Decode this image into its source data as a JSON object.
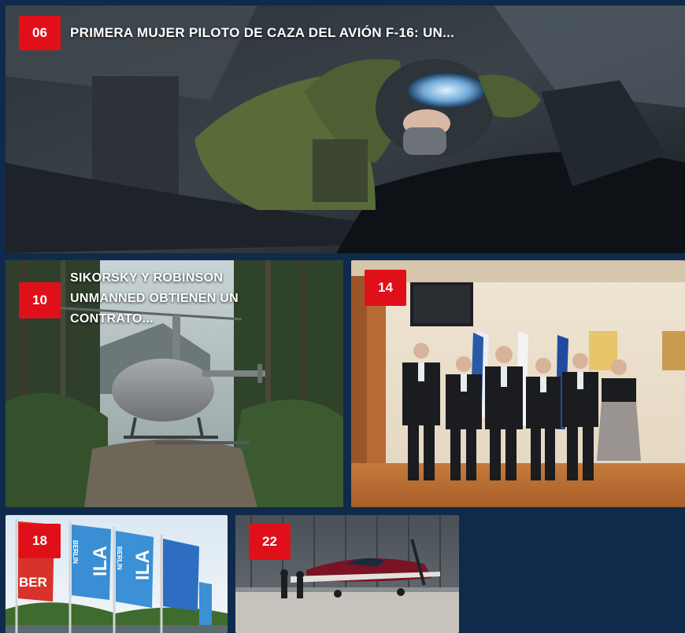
{
  "cards": [
    {
      "number": "06",
      "title": "PRIMERA MUJER PILOTO DE CAZA DEL AVIÓN F-16: UN..."
    },
    {
      "number": "10",
      "title": "SIKORSKY Y ROBINSON UNMANNED OBTIENEN UN CONTRATO..."
    },
    {
      "number": "14",
      "title": ""
    },
    {
      "number": "18",
      "title": "",
      "flag_texts": [
        "BER",
        "ILA",
        "BERLIN",
        "ILA",
        "BERLIN"
      ]
    },
    {
      "number": "22",
      "title": ""
    }
  ],
  "colors": {
    "background": "#102a4c",
    "badge": "#e0101a"
  }
}
